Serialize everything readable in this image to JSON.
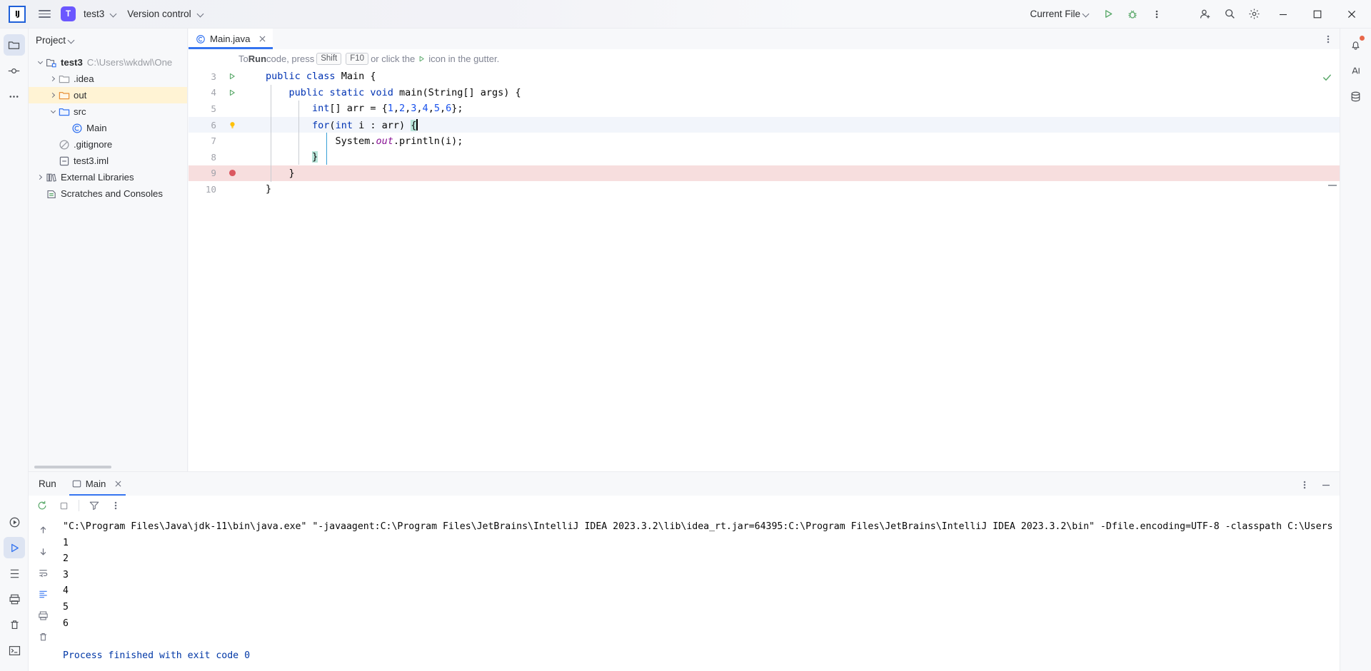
{
  "window": {
    "app_logo": "IJ",
    "menu_icon": "hamburger-icon",
    "project_chip": "T",
    "project_name": "test3",
    "version_control": "Version control"
  },
  "toolbar": {
    "run_config": "Current File",
    "run_icon": "run-play-icon",
    "debug_icon": "debug-bug-icon",
    "more_icon": "more-vertical-icon",
    "account_icon": "account-add-icon",
    "search_icon": "search-icon",
    "settings_icon": "gear-icon",
    "minimize_icon": "window-minimize-icon",
    "maximize_icon": "window-maximize-icon",
    "close_icon": "window-close-icon"
  },
  "left_rail": {
    "items": [
      {
        "name": "project-tool-window",
        "icon": "folder-icon",
        "active": true
      },
      {
        "name": "commit-tool-window",
        "icon": "commit-icon",
        "active": false
      },
      {
        "name": "more-tool-windows",
        "icon": "more-horizontal-icon",
        "active": false
      }
    ],
    "bottom": [
      {
        "name": "run-tool-window",
        "icon": "run-circle-icon",
        "active": false
      },
      {
        "name": "debug-tool-window",
        "icon": "run-play-icon",
        "active": true
      },
      {
        "name": "structure-tool-window",
        "icon": "structure-icon",
        "active": false
      },
      {
        "name": "problems-tool-window",
        "icon": "printer-icon",
        "active": false
      },
      {
        "name": "trash",
        "icon": "trash-icon",
        "active": false
      },
      {
        "name": "terminal-tool-window",
        "icon": "terminal-icon",
        "active": false
      }
    ]
  },
  "right_rail": {
    "items": [
      {
        "name": "notifications",
        "icon": "bell-icon"
      },
      {
        "name": "ai-assistant",
        "icon": "ai-icon"
      },
      {
        "name": "database",
        "icon": "database-icon"
      }
    ]
  },
  "project": {
    "header": "Project",
    "tree": [
      {
        "label": "test3",
        "path": "C:\\Users\\wkdwl\\One",
        "icon": "module-icon",
        "indent": 0,
        "arrow": "down",
        "bold": true,
        "selected": false
      },
      {
        "label": ".idea",
        "path": "",
        "icon": "folder-icon",
        "indent": 1,
        "arrow": "right",
        "bold": false,
        "selected": false
      },
      {
        "label": "out",
        "path": "",
        "icon": "folder-orange-icon",
        "indent": 1,
        "arrow": "right",
        "bold": false,
        "selected": true
      },
      {
        "label": "src",
        "path": "",
        "icon": "folder-blue-icon",
        "indent": 1,
        "arrow": "down",
        "bold": false,
        "selected": false
      },
      {
        "label": "Main",
        "path": "",
        "icon": "java-class-icon",
        "indent": 2,
        "arrow": "none",
        "bold": false,
        "selected": false
      },
      {
        "label": ".gitignore",
        "path": "",
        "icon": "gitignore-icon",
        "indent": 1,
        "arrow": "none",
        "bold": false,
        "selected": false
      },
      {
        "label": "test3.iml",
        "path": "",
        "icon": "iml-file-icon",
        "indent": 1,
        "arrow": "none",
        "bold": false,
        "selected": false
      },
      {
        "label": "External Libraries",
        "path": "",
        "icon": "libraries-icon",
        "indent": 0,
        "arrow": "right",
        "bold": false,
        "selected": false
      },
      {
        "label": "Scratches and Consoles",
        "path": "",
        "icon": "scratches-icon",
        "indent": 0,
        "arrow": "none",
        "bold": false,
        "selected": false
      }
    ]
  },
  "editor": {
    "tab": {
      "label": "Main.java",
      "icon": "java-class-icon",
      "close_icon": "close-icon"
    },
    "options_icon": "more-vertical-icon",
    "hint": {
      "prefix": "To ",
      "run_word": "Run",
      "mid": " code, press ",
      "key1": "Shift",
      "key2": "F10",
      "suffix": " or click the ",
      "tail": " icon in the gutter.",
      "gutter_icon": "run-play-icon"
    },
    "inspection_status_icon": "checkmark-ok-icon",
    "lines": [
      {
        "num": "3",
        "gutter": "run",
        "highlight": "none",
        "tokens": [
          {
            "t": "public",
            "c": "k"
          },
          {
            "t": " ",
            "c": ""
          },
          {
            "t": "class",
            "c": "k"
          },
          {
            "t": " Main {",
            "c": ""
          }
        ]
      },
      {
        "num": "4",
        "gutter": "run",
        "highlight": "none",
        "tokens": [
          {
            "t": "    ",
            "c": ""
          },
          {
            "t": "public",
            "c": "k"
          },
          {
            "t": " ",
            "c": ""
          },
          {
            "t": "static",
            "c": "k"
          },
          {
            "t": " ",
            "c": ""
          },
          {
            "t": "void",
            "c": "k"
          },
          {
            "t": " main(String[] args) {",
            "c": ""
          }
        ]
      },
      {
        "num": "5",
        "gutter": "none",
        "highlight": "none",
        "tokens": [
          {
            "t": "        ",
            "c": ""
          },
          {
            "t": "int",
            "c": "k"
          },
          {
            "t": "[] arr = {",
            "c": ""
          },
          {
            "t": "1",
            "c": "num"
          },
          {
            "t": ",",
            "c": ""
          },
          {
            "t": "2",
            "c": "num"
          },
          {
            "t": ",",
            "c": ""
          },
          {
            "t": "3",
            "c": "num"
          },
          {
            "t": ",",
            "c": ""
          },
          {
            "t": "4",
            "c": "num"
          },
          {
            "t": ",",
            "c": ""
          },
          {
            "t": "5",
            "c": "num"
          },
          {
            "t": ",",
            "c": ""
          },
          {
            "t": "6",
            "c": "num"
          },
          {
            "t": "};",
            "c": ""
          }
        ]
      },
      {
        "num": "6",
        "gutter": "bulb",
        "highlight": "current",
        "tokens": [
          {
            "t": "        ",
            "c": ""
          },
          {
            "t": "for",
            "c": "k"
          },
          {
            "t": "(",
            "c": ""
          },
          {
            "t": "int",
            "c": "k"
          },
          {
            "t": " i : arr) ",
            "c": ""
          },
          {
            "t": "{",
            "c": "brmatch"
          },
          {
            "t": "|CARET|",
            "c": "caret"
          }
        ]
      },
      {
        "num": "7",
        "gutter": "none",
        "highlight": "none",
        "tokens": [
          {
            "t": "            System.",
            "c": ""
          },
          {
            "t": "out",
            "c": "fld"
          },
          {
            "t": ".println(i);",
            "c": ""
          }
        ]
      },
      {
        "num": "8",
        "gutter": "none",
        "highlight": "none",
        "tokens": [
          {
            "t": "        ",
            "c": ""
          },
          {
            "t": "}",
            "c": "brmatch"
          }
        ]
      },
      {
        "num": "9",
        "gutter": "breakpoint",
        "highlight": "breakpoint",
        "tokens": [
          {
            "t": "    }",
            "c": ""
          }
        ]
      },
      {
        "num": "10",
        "gutter": "none",
        "highlight": "none",
        "tokens": [
          {
            "t": "}",
            "c": ""
          }
        ]
      }
    ]
  },
  "run_panel": {
    "title": "Run",
    "tab_label": "Main",
    "tab_icon": "run-config-icon",
    "tab_close_icon": "close-icon",
    "options_icon": "more-vertical-icon",
    "hide_icon": "minimize-icon",
    "toolbar": [
      {
        "name": "rerun-button",
        "icon": "rerun-icon"
      },
      {
        "name": "stop-button",
        "icon": "stop-icon"
      },
      {
        "name": "filter-button",
        "icon": "filter-icon"
      },
      {
        "name": "console-options-button",
        "icon": "more-vertical-icon"
      }
    ],
    "side_toolbar": [
      {
        "name": "scroll-up-button",
        "icon": "arrow-up-icon"
      },
      {
        "name": "scroll-down-button",
        "icon": "arrow-down-icon"
      },
      {
        "name": "soft-wrap-button",
        "icon": "wrap-icon"
      },
      {
        "name": "scroll-to-end-button",
        "icon": "scroll-end-icon"
      },
      {
        "name": "print-button",
        "icon": "printer-icon"
      },
      {
        "name": "clear-all-button",
        "icon": "trash-icon"
      }
    ],
    "console_lines": [
      {
        "text": "\"C:\\Program Files\\Java\\jdk-11\\bin\\java.exe\" \"-javaagent:C:\\Program Files\\JetBrains\\IntelliJ IDEA 2023.3.2\\lib\\idea_rt.jar=64395:C:\\Program Files\\JetBrains\\IntelliJ IDEA 2023.3.2\\bin\" -Dfile.encoding=UTF-8 -classpath C:\\Users",
        "style": "cmd"
      },
      {
        "text": "1",
        "style": "cmd"
      },
      {
        "text": "2",
        "style": "cmd"
      },
      {
        "text": "3",
        "style": "cmd"
      },
      {
        "text": "4",
        "style": "cmd"
      },
      {
        "text": "5",
        "style": "cmd"
      },
      {
        "text": "6",
        "style": "cmd"
      },
      {
        "text": "",
        "style": "cmd"
      },
      {
        "text": "Process finished with exit code 0",
        "style": "done"
      }
    ]
  },
  "colors": {
    "accent": "#3574F0",
    "keyword": "#0033B3",
    "number": "#1750EB",
    "field": "#871094",
    "selected_row": "#FFF3D4",
    "breakpoint": "#DB5860",
    "breakpoint_row": "#F7DEDE",
    "run_green": "#59A869",
    "bulb": "#FFC107",
    "project_chip": "#6B57FF",
    "toolbar_bg": "#F7F8FA"
  }
}
